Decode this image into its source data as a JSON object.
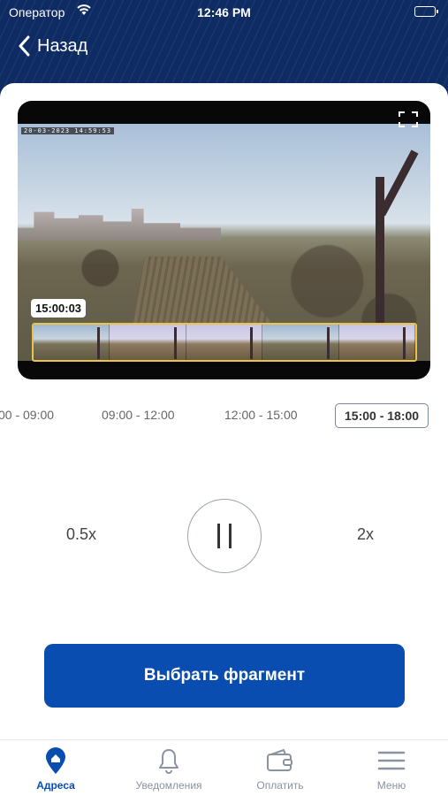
{
  "status_bar": {
    "carrier": "Оператор",
    "time": "12:46 PM"
  },
  "header": {
    "back_label": "Назад"
  },
  "video": {
    "osd_timestamp": "20-03-2023 14:59:53",
    "current_time": "15:00:03",
    "thumbnails": 5
  },
  "timeslots": [
    {
      "label": "00 - 09:00"
    },
    {
      "label": "09:00 - 12:00"
    },
    {
      "label": "12:00 - 15:00"
    },
    {
      "label": "15:00 - 18:00",
      "active": true
    }
  ],
  "controls": {
    "slow_label": "0.5x",
    "fast_label": "2x",
    "state": "playing"
  },
  "cta": {
    "label": "Выбрать фрагмент"
  },
  "tabbar": {
    "items": [
      {
        "label": "Адреса",
        "icon": "home-pin-icon",
        "active": true
      },
      {
        "label": "Уведомления",
        "icon": "bell-icon"
      },
      {
        "label": "Оплатить",
        "icon": "wallet-icon"
      },
      {
        "label": "Меню",
        "icon": "menu-icon"
      }
    ]
  },
  "colors": {
    "accent": "#0a4db0",
    "header_bg": "#0e2c63",
    "highlight": "#e9c34a"
  }
}
